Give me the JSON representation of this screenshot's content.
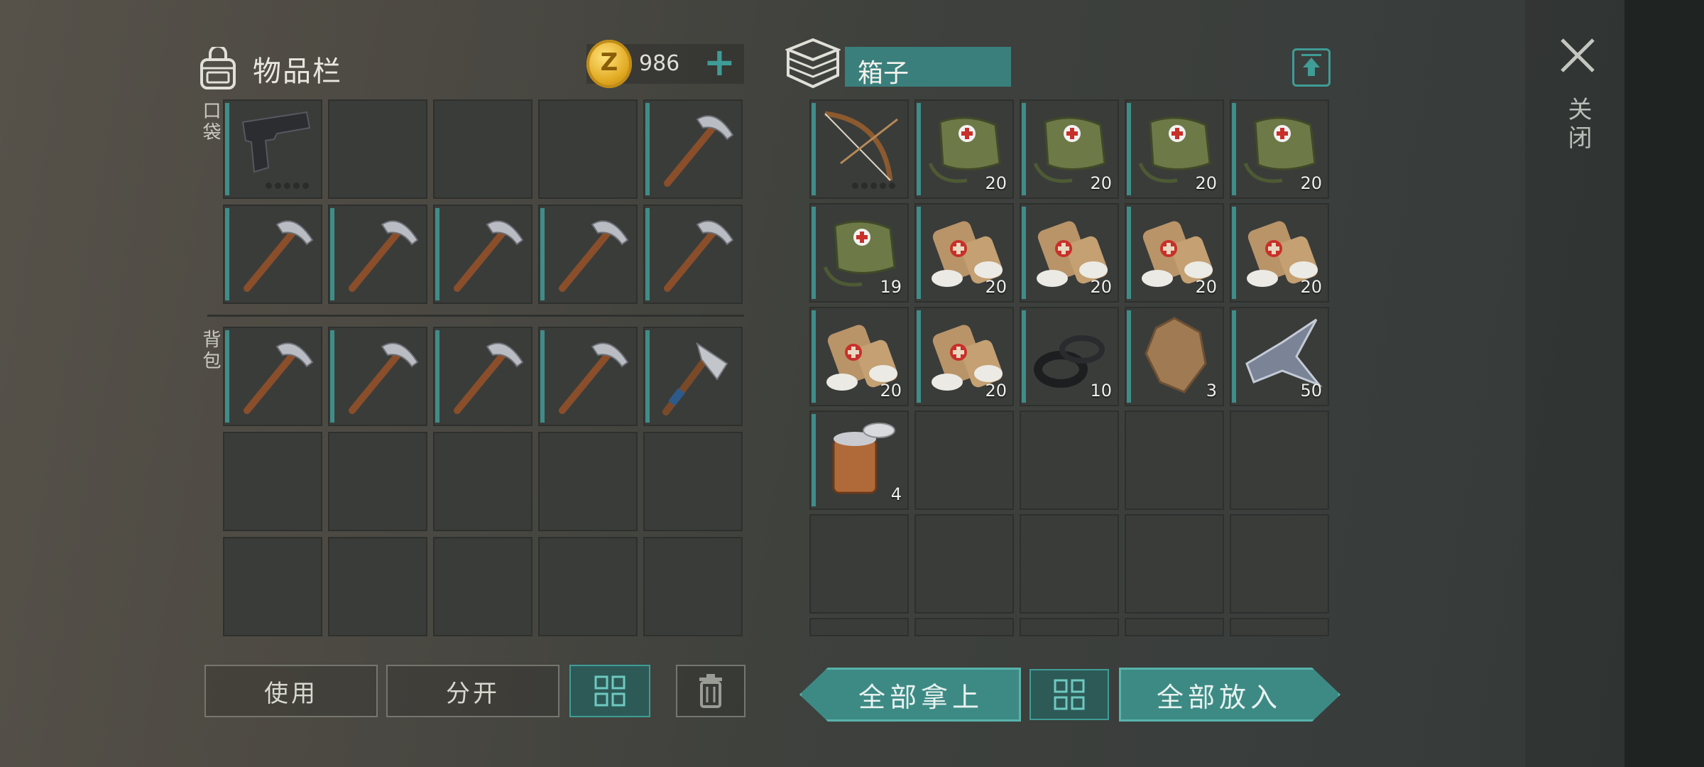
{
  "inventory": {
    "title": "物品栏",
    "coins": "986",
    "add_label": "+",
    "pockets_label": "口袋",
    "backpack_label": "背包"
  },
  "pockets": [
    {
      "item": "pistol-icon",
      "count": ""
    },
    {
      "item": "",
      "count": ""
    },
    {
      "item": "",
      "count": ""
    },
    {
      "item": "",
      "count": ""
    },
    {
      "item": "pickaxe-icon",
      "count": ""
    },
    {
      "item": "pickaxe-icon",
      "count": ""
    },
    {
      "item": "pickaxe-icon",
      "count": ""
    },
    {
      "item": "pickaxe-icon",
      "count": ""
    },
    {
      "item": "pickaxe-icon",
      "count": ""
    },
    {
      "item": "pickaxe-icon",
      "count": ""
    }
  ],
  "backpack": [
    {
      "item": "pickaxe-icon",
      "count": ""
    },
    {
      "item": "pickaxe-icon",
      "count": ""
    },
    {
      "item": "pickaxe-icon",
      "count": ""
    },
    {
      "item": "pickaxe-icon",
      "count": ""
    },
    {
      "item": "hatchet-icon",
      "count": ""
    }
  ],
  "box": {
    "title": "箱子",
    "items": [
      {
        "item": "bow-icon",
        "count": ""
      },
      {
        "item": "medkit-bag-icon",
        "count": "20"
      },
      {
        "item": "medkit-bag-icon",
        "count": "20"
      },
      {
        "item": "medkit-bag-icon",
        "count": "20"
      },
      {
        "item": "medkit-bag-icon",
        "count": "20"
      },
      {
        "item": "medkit-bag-icon",
        "count": "19"
      },
      {
        "item": "bandage-icon",
        "count": "20"
      },
      {
        "item": "bandage-icon",
        "count": "20"
      },
      {
        "item": "bandage-icon",
        "count": "20"
      },
      {
        "item": "bandage-icon",
        "count": "20"
      },
      {
        "item": "bandage-icon",
        "count": "20"
      },
      {
        "item": "bandage-icon",
        "count": "20"
      },
      {
        "item": "rubber-ring-icon",
        "count": "10"
      },
      {
        "item": "fur-pelt-icon",
        "count": "3"
      },
      {
        "item": "metal-scrap-icon",
        "count": "50"
      },
      {
        "item": "food-can-icon",
        "count": "4"
      }
    ]
  },
  "buttons": {
    "use": "使用",
    "split": "分开",
    "take_all": "全部拿上",
    "put_all": "全部放入"
  },
  "close_label": "关闭",
  "colors": {
    "accent": "#3f9c96",
    "slot": "#3a3c3a",
    "box_title_bg": "#3a7f7c"
  }
}
